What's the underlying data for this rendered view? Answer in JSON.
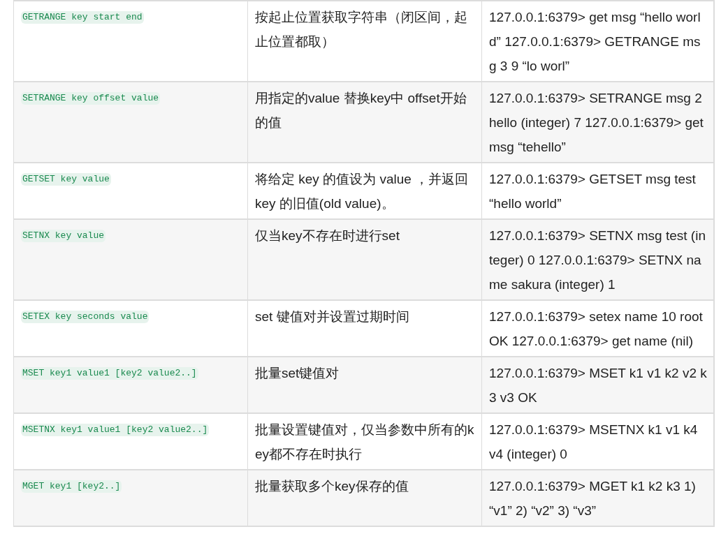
{
  "table": {
    "rows": [
      {
        "command": "GETRANGE key start end",
        "description": "按起止位置获取字符串（闭区间，起止位置都取）",
        "example": "127.0.0.1:6379> get msg “hello world” 127.0.0.1:6379> GETRANGE msg 3 9 “lo worl”"
      },
      {
        "command": "SETRANGE key offset value",
        "description": "用指定的value 替换key中 offset开始的值",
        "example": "127.0.0.1:6379> SETRANGE msg 2 hello (integer) 7 127.0.0.1:6379> get msg “tehello”"
      },
      {
        "command": "GETSET key value",
        "description": "将给定 key 的值设为 value ，并返回 key 的旧值(old value)。",
        "example": "127.0.0.1:6379> GETSET msg test “hello world”"
      },
      {
        "command": "SETNX key value",
        "description": "仅当key不存在时进行set",
        "example": "127.0.0.1:6379> SETNX msg test (integer) 0 127.0.0.1:6379> SETNX name sakura (integer) 1"
      },
      {
        "command": "SETEX key seconds value",
        "description": "set 键值对并设置过期时间",
        "example": "127.0.0.1:6379> setex name 10 root OK 127.0.0.1:6379> get name (nil)"
      },
      {
        "command": "MSET key1 value1 [key2 value2..]",
        "description": "批量set键值对",
        "example": "127.0.0.1:6379> MSET k1 v1 k2 v2 k3 v3 OK"
      },
      {
        "command": "MSETNX key1 value1 [key2 value2..]",
        "description": "批量设置键值对，仅当参数中所有的key都不存在时执行",
        "example": "127.0.0.1:6379> MSETNX k1 v1 k4 v4 (integer) 0"
      },
      {
        "command": "MGET key1 [key2..]",
        "description": "批量获取多个key保存的值",
        "example": "127.0.0.1:6379> MGET k1 k2 k3 1) “v1” 2) “v2” 3) “v3”"
      }
    ]
  }
}
